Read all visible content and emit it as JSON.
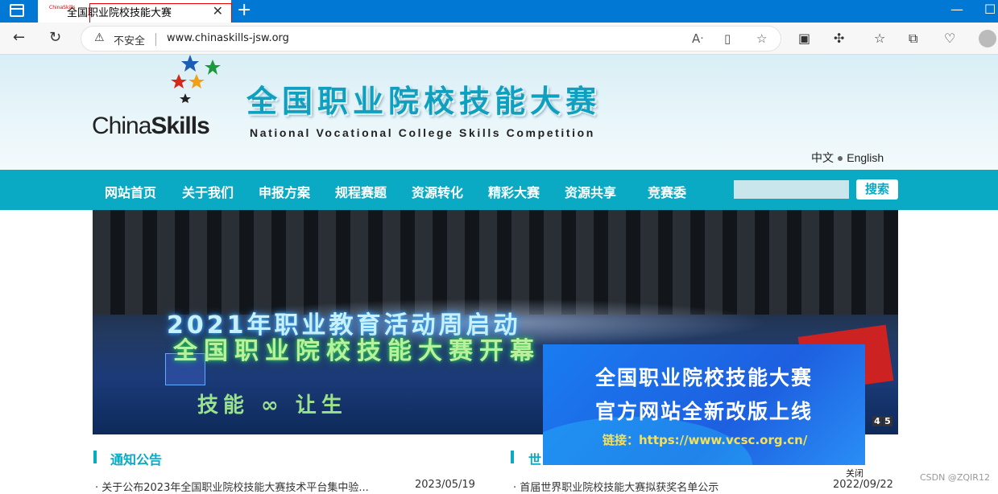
{
  "browser": {
    "tab_title": "全国职业院校技能大赛",
    "tab_favicon": "ChinaSkills",
    "security": "不安全",
    "url": "www.chinaskills-jsw.org",
    "close_tab": "✕",
    "new_tab": "+",
    "minimize": "—",
    "maximize": "☐"
  },
  "site": {
    "brand_plain": "China",
    "brand_bold": "Skills",
    "title_cn": "全国职业院校技能大赛",
    "title_en": "National Vocational College Skills Competition",
    "lang_cn": "中文",
    "lang_en": "English"
  },
  "menu": {
    "items": [
      "网站首页",
      "关于我们",
      "申报方案",
      "规程赛题",
      "资源转化",
      "精彩大赛",
      "资源共享",
      "竞赛委"
    ],
    "search_label": "搜索"
  },
  "banner": {
    "line1": "2021年职业教育活动周启动",
    "line2": "全国职业院校技能大赛开幕",
    "line3": "技能 ∞ 让生",
    "pager": [
      "4",
      "5"
    ]
  },
  "popup": {
    "line1": "全国职业院校技能大赛",
    "line2": "官方网站全新改版上线",
    "link": "链接：https://www.vcsc.org.cn/",
    "close": "关闭"
  },
  "left_section": {
    "title": "通知公告",
    "item_text": "· 关于公布2023年全国职业院校技能大赛技术平台集中验...",
    "item_date": "2023/05/19"
  },
  "right_section": {
    "title": "世",
    "item_text": "· 首届世界职业院校技能大赛拟获奖名单公示",
    "item_date": "2022/09/22"
  },
  "watermark": "CSDN @ZQIR12"
}
